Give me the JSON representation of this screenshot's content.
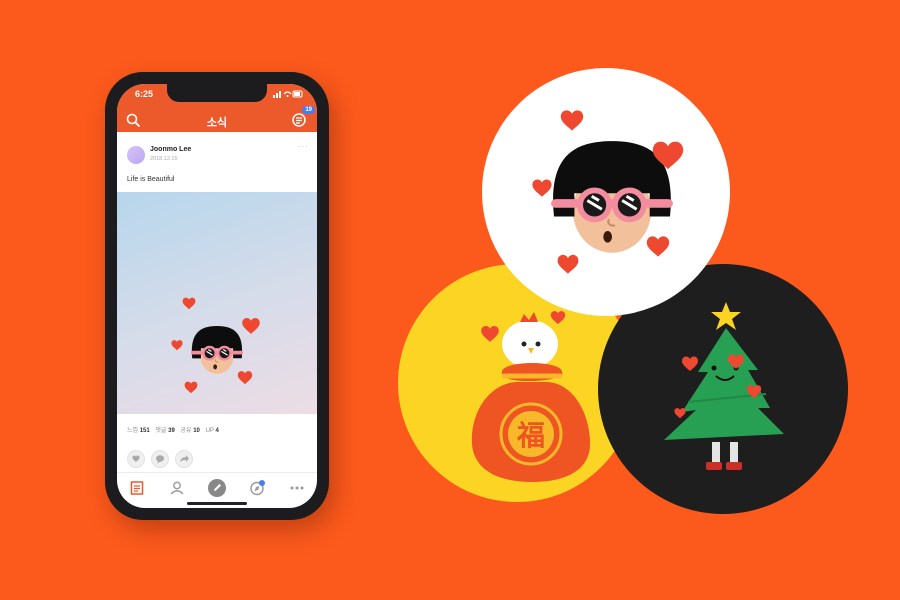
{
  "status_bar": {
    "time": "6:25"
  },
  "header": {
    "title": "소식",
    "notification_count": "19"
  },
  "post": {
    "author": "Joonmo Lee",
    "date": "2018.12.15",
    "text": "Life is Beautiful",
    "more": "···"
  },
  "stats": {
    "items": [
      {
        "label": "느낌",
        "value": "151"
      },
      {
        "label": "댓글",
        "value": "39"
      },
      {
        "label": "공유",
        "value": "10"
      },
      {
        "label": "UP",
        "value": "4"
      }
    ]
  },
  "actions": [
    "heart-icon",
    "comment-icon",
    "share-icon"
  ],
  "tabs": [
    "news-icon",
    "profile-icon",
    "write-icon",
    "explore-icon",
    "more-icon"
  ],
  "colors": {
    "background": "#fc5a1c",
    "header": "#ec5a2c",
    "badge": "#4a7cf0",
    "heart": "#ef4830",
    "circle_yellow": "#fcd424",
    "circle_black": "#1e1e1e"
  },
  "badges": {
    "lucky_bag_character": "福"
  }
}
